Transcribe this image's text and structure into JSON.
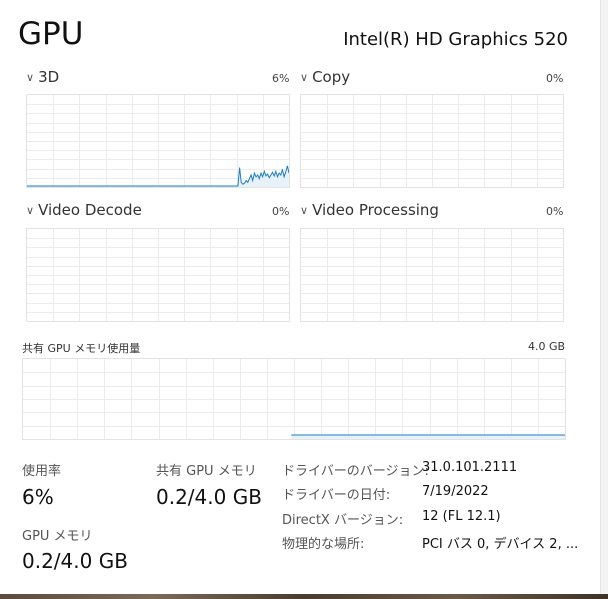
{
  "header": {
    "title": "GPU",
    "gpu_name": "Intel(R) HD Graphics 520"
  },
  "graphs": [
    {
      "label": "3D",
      "percent": "6%",
      "values": [
        0,
        0,
        0,
        0,
        0,
        0,
        0,
        0,
        0,
        0,
        0,
        0,
        0,
        0,
        0,
        0,
        0,
        0,
        0,
        0,
        0,
        0,
        0,
        0,
        0,
        0,
        0,
        0,
        0,
        0,
        0,
        0,
        0,
        0,
        0,
        0,
        0,
        0,
        0,
        0,
        0,
        0,
        0,
        0,
        0,
        0,
        0,
        0,
        0,
        0,
        0,
        0,
        0,
        0,
        0,
        0,
        0,
        0,
        0,
        0,
        0,
        0,
        0,
        0,
        0,
        0,
        0,
        0,
        0,
        0,
        0,
        0,
        0,
        0,
        0,
        0,
        0,
        0,
        0,
        0,
        0,
        0,
        0,
        0,
        0,
        0,
        0,
        0,
        0,
        0,
        0,
        0,
        0,
        0,
        0,
        0,
        0,
        0,
        0,
        0,
        0,
        0,
        0,
        0,
        0,
        0,
        0,
        0,
        0,
        0,
        0,
        0,
        0,
        0,
        0,
        0,
        0,
        0,
        0,
        0,
        0,
        0,
        0,
        0,
        0,
        0,
        0,
        0,
        0,
        20,
        4,
        2,
        3,
        6,
        4,
        8,
        12,
        6,
        14,
        10,
        12,
        8,
        14,
        10,
        16,
        11,
        13,
        9,
        12,
        15,
        11,
        16,
        10,
        14,
        12,
        18,
        10,
        15,
        22,
        14
      ]
    },
    {
      "label": "Copy",
      "percent": "0%",
      "values": []
    },
    {
      "label": "Video Decode",
      "percent": "0%",
      "values": []
    },
    {
      "label": "Video Processing",
      "percent": "0%",
      "values": []
    }
  ],
  "shared_memory": {
    "label": "共有 GPU メモリ使用量",
    "max": "4.0 GB",
    "level_fraction": 0.05
  },
  "stats": {
    "utilization_label": "使用率",
    "utilization_value": "6%",
    "shared_mem_label": "共有 GPU メモリ",
    "shared_mem_value": "0.2/4.0 GB",
    "gpu_mem_label": "GPU メモリ",
    "gpu_mem_value": "0.2/4.0 GB"
  },
  "properties": [
    {
      "key": "ドライバーのバージョン:",
      "value": "31.0.101.2111"
    },
    {
      "key": "ドライバーの日付:",
      "value": "7/19/2022"
    },
    {
      "key": "DirectX バージョン:",
      "value": "12 (FL 12.1)"
    },
    {
      "key": "物理的な場所:",
      "value": "PCI バス 0, デバイス 2, ..."
    }
  ],
  "colors": {
    "line": "#1b7ec2",
    "fill": "#e7f1fa",
    "grid": "#ececec",
    "border": "#d6d6d6"
  }
}
